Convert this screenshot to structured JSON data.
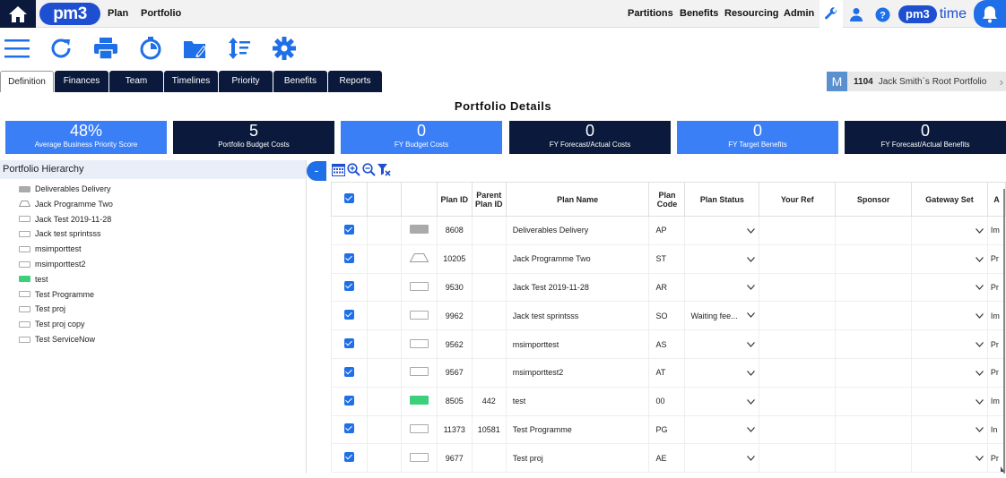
{
  "topnav": {
    "logo": "pm3",
    "items": [
      "Plan",
      "Portfolio"
    ],
    "right_items": [
      "Partitions",
      "Benefits",
      "Resourcing",
      "Admin"
    ],
    "time_logo": {
      "pm": "pm3",
      "time": "time"
    }
  },
  "toolbar": {
    "icons": [
      "menu-icon",
      "refresh-icon",
      "print-icon",
      "timer-icon",
      "folder-edit-icon",
      "sort-icon",
      "gear-icon"
    ]
  },
  "tabs": [
    {
      "label": "Definition",
      "active": true
    },
    {
      "label": "Finances",
      "active": false
    },
    {
      "label": "Team",
      "active": false
    },
    {
      "label": "Timelines",
      "active": false
    },
    {
      "label": "Priority Matrix",
      "active": false
    },
    {
      "label": "Benefits",
      "active": false
    },
    {
      "label": "Reports",
      "active": false
    }
  ],
  "breadcrumb": {
    "badge": "M",
    "id": "1104",
    "name": "Jack Smith`s Root Portfolio"
  },
  "page_title": "Portfolio Details",
  "kpis": [
    {
      "value": "48%",
      "label": "Average Business Priority Score",
      "color": "blue"
    },
    {
      "value": "5",
      "label": "Portfolio Budget Costs",
      "color": "navy"
    },
    {
      "value": "0",
      "label": "FY Budget Costs",
      "color": "blue"
    },
    {
      "value": "0",
      "label": "FY Forecast/Actual Costs",
      "color": "navy"
    },
    {
      "value": "0",
      "label": "FY Target Benefits",
      "color": "blue"
    },
    {
      "value": "0",
      "label": "FY Forecast/Actual Benefits",
      "color": "navy"
    }
  ],
  "hierarchy": {
    "title": "Portfolio Hierarchy",
    "collapse_label": "-",
    "items": [
      {
        "label": "Deliverables Delivery",
        "swatch": "gray"
      },
      {
        "label": "Jack Programme Two",
        "swatch": "trapezoid"
      },
      {
        "label": "Jack Test 2019-11-28",
        "swatch": "empty"
      },
      {
        "label": "Jack test sprintsss",
        "swatch": "empty"
      },
      {
        "label": "msimporttest",
        "swatch": "empty"
      },
      {
        "label": "msimporttest2",
        "swatch": "empty"
      },
      {
        "label": "test",
        "swatch": "green"
      },
      {
        "label": "Test Programme",
        "swatch": "empty"
      },
      {
        "label": "Test proj",
        "swatch": "empty"
      },
      {
        "label": "Test proj copy",
        "swatch": "empty"
      },
      {
        "label": "Test ServiceNow",
        "swatch": "empty"
      }
    ]
  },
  "grid": {
    "columns": {
      "plan_id": "Plan ID",
      "parent": "Parent Plan ID",
      "name": "Plan Name",
      "code": "Plan Code",
      "status": "Plan Status",
      "ref": "Your Ref",
      "sponsor": "Sponsor",
      "gateway": "Gateway Set",
      "extra": "A"
    },
    "rows": [
      {
        "id": "8608",
        "parent": "",
        "name": "Deliverables Delivery",
        "code": "AP",
        "status": "",
        "extra": "Im",
        "swatch": "gray"
      },
      {
        "id": "10205",
        "parent": "",
        "name": "Jack Programme Two",
        "code": "ST",
        "status": "",
        "extra": "Pr",
        "swatch": "trapezoid"
      },
      {
        "id": "9530",
        "parent": "",
        "name": "Jack Test 2019-11-28",
        "code": "AR",
        "status": "",
        "extra": "Pr",
        "swatch": "empty"
      },
      {
        "id": "9962",
        "parent": "",
        "name": "Jack test sprintsss",
        "code": "SO",
        "status": "Waiting fee...",
        "extra": "Im",
        "swatch": "empty"
      },
      {
        "id": "9562",
        "parent": "",
        "name": "msimporttest",
        "code": "AS",
        "status": "",
        "extra": "Pr",
        "swatch": "empty"
      },
      {
        "id": "9567",
        "parent": "",
        "name": "msimporttest2",
        "code": "AT",
        "status": "",
        "extra": "Pr",
        "swatch": "empty"
      },
      {
        "id": "8505",
        "parent": "442",
        "name": "test",
        "code": "00",
        "status": "",
        "extra": "Im",
        "swatch": "green"
      },
      {
        "id": "11373",
        "parent": "10581",
        "name": "Test Programme",
        "code": "PG",
        "status": "",
        "extra": "In",
        "swatch": "empty"
      },
      {
        "id": "9677",
        "parent": "",
        "name": "Test proj",
        "code": "AE",
        "status": "",
        "extra": "Pr",
        "swatch": "empty"
      }
    ]
  },
  "colors": {
    "navy": "#0b1a3c",
    "blue": "#3a7ff6",
    "accent": "#1f6fe8",
    "green": "#3ccf7c",
    "gray": "#aaaaaa"
  }
}
